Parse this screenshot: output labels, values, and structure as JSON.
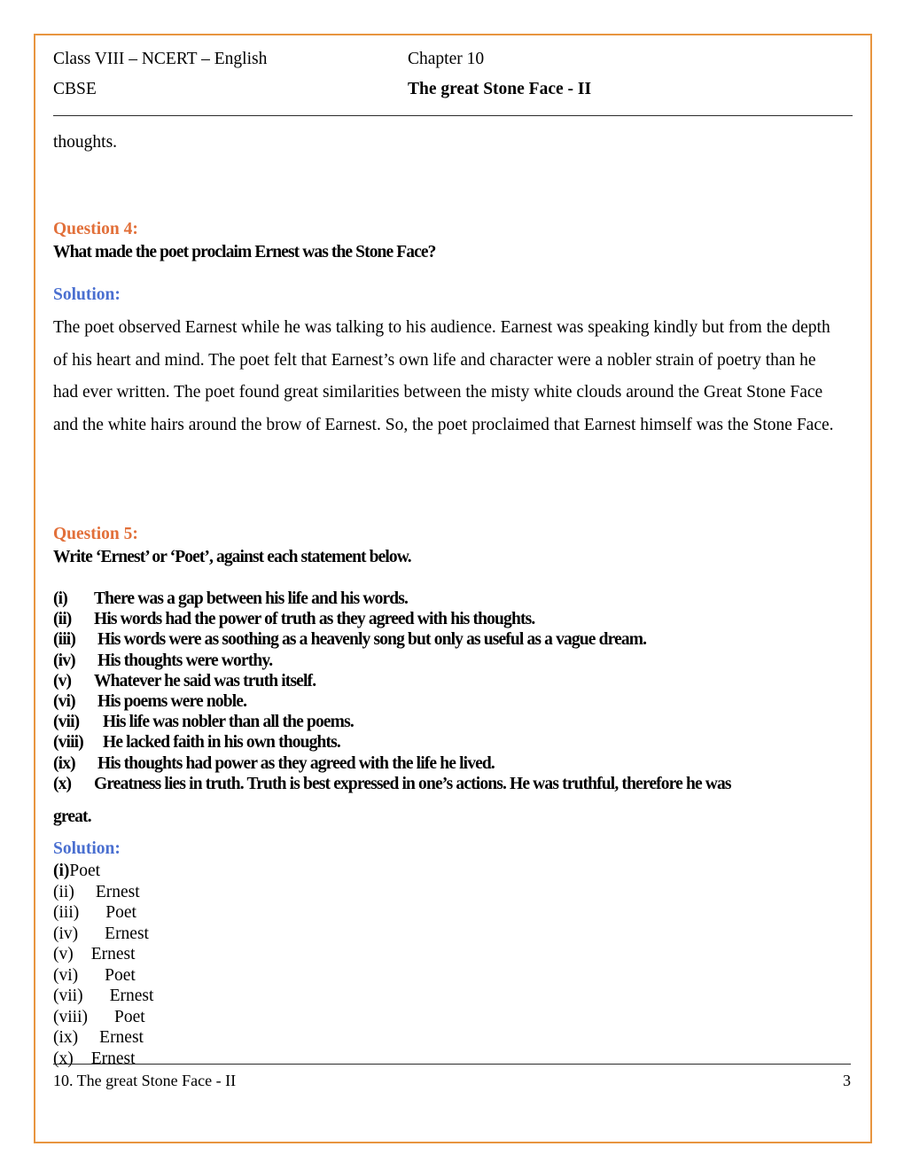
{
  "header": {
    "line1_left": "Class VIII – NCERT – English",
    "line1_right": "Chapter 10",
    "line2_left": "CBSE",
    "line2_right": "The great Stone Face - II"
  },
  "body": {
    "continued_text": "thoughts.",
    "question4": {
      "label": "Question 4:",
      "text": "What made the poet proclaim Ernest was the Stone Face?",
      "solution_label": "Solution:",
      "solution_text": "The poet observed Earnest while he was talking to his audience. Earnest was speaking kindly but from the depth of his heart and mind. The poet felt that Earnest’s own life and character were a nobler strain of poetry than he had ever written. The poet found great similarities between the misty white clouds around the Great Stone Face and the white hairs around the brow of Earnest. So, the poet proclaimed that Earnest himself was the Stone   Face."
    },
    "question5": {
      "label": "Question 5:",
      "text": "Write ‘Ernest’ or ‘Poet’, against each statement below.",
      "statements": [
        {
          "marker": "(i)",
          "text": "There was a gap between his life and his words."
        },
        {
          "marker": "(ii)",
          "text": "His words had the power of truth as they agreed with his thoughts."
        },
        {
          "marker": "(iii)",
          "text": "His words were as soothing as a heavenly song but only as useful as a vague dream."
        },
        {
          "marker": "(iv)",
          "text": "His thoughts were worthy."
        },
        {
          "marker": "(v)",
          "text": "Whatever he said was truth itself."
        },
        {
          "marker": "(vi)",
          "text": "His poems were noble."
        },
        {
          "marker": "(vii)",
          "text": "His life was nobler than all the poems."
        },
        {
          "marker": "(viii)",
          "text": "He lacked faith in his own thoughts."
        },
        {
          "marker": "(ix)",
          "text": "His thoughts had power as they agreed with the life he lived."
        },
        {
          "marker": "(x)",
          "text": "Greatness lies in truth. Truth is best expressed in one’s actions. He was truthful, therefore he was"
        }
      ],
      "statements_wrap_tail": "great.",
      "solution_label": "Solution:",
      "answers": [
        {
          "marker": "(i)",
          "value": "Poet"
        },
        {
          "marker": "(ii)",
          "value": "Ernest"
        },
        {
          "marker": "(iii)",
          "value": "Poet"
        },
        {
          "marker": "(iv)",
          "value": "Ernest"
        },
        {
          "marker": "(v)",
          "value": "Ernest"
        },
        {
          "marker": "(vi)",
          "value": "Poet"
        },
        {
          "marker": "(vii)",
          "value": "Ernest"
        },
        {
          "marker": "(viii)",
          "value": "Poet"
        },
        {
          "marker": "(ix)",
          "value": "Ernest"
        },
        {
          "marker": "(x)",
          "value": "Ernest"
        }
      ]
    }
  },
  "footer": {
    "left": "10. The great Stone Face - II",
    "page_number": "3"
  },
  "colors": {
    "question_accent": "#E2703A",
    "solution_accent": "#4A6FD0",
    "page_border": "#E8953F"
  }
}
